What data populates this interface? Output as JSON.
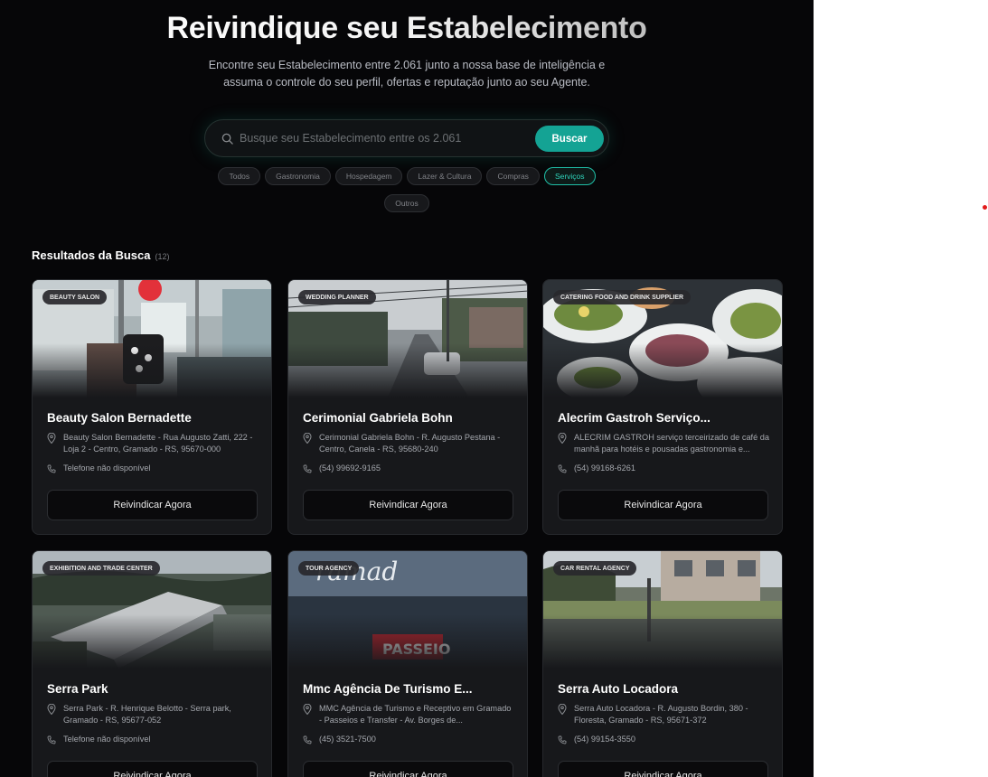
{
  "header": {
    "title": "Reivindique seu Estabelecimento",
    "subtitle": "Encontre seu Estabelecimento entre 2.061 junto a nossa base de inteligência e assuma o controle do seu perfil, ofertas e reputação junto ao seu Agente."
  },
  "search": {
    "placeholder": "Busque seu Estabelecimento entre os 2.061",
    "button_label": "Buscar"
  },
  "filters": [
    {
      "label": "Todos",
      "active": false
    },
    {
      "label": "Gastronomia",
      "active": false
    },
    {
      "label": "Hospedagem",
      "active": false
    },
    {
      "label": "Lazer & Cultura",
      "active": false
    },
    {
      "label": "Compras",
      "active": false
    },
    {
      "label": "Serviços",
      "active": true
    },
    {
      "label": "Outros",
      "active": false
    }
  ],
  "results": {
    "title": "Resultados da Busca",
    "count": "(12)"
  },
  "cards": [
    {
      "category": "Beauty Salon",
      "name": "Beauty Salon Bernadette",
      "address": "Beauty Salon Bernadette - Rua Augusto Zatti, 222 - Loja 2 - Centro, Gramado - RS, 95670-000",
      "phone": "Telefone não disponível",
      "button": "Reivindicar Agora"
    },
    {
      "category": "Wedding Planner",
      "name": "Cerimonial Gabriela Bohn",
      "address": "Cerimonial Gabriela Bohn - R. Augusto Pestana - Centro, Canela - RS, 95680-240",
      "phone": "(54) 99692-9165",
      "button": "Reivindicar Agora"
    },
    {
      "category": "Catering Food and Drink Supplier",
      "name": "Alecrim Gastroh Serviço...",
      "address": "ALECRIM GASTROH serviço terceirizado de café da manhã para hotéis e pousadas gastronomia e...",
      "phone": "(54) 99168-6261",
      "button": "Reivindicar Agora"
    },
    {
      "category": "Exhibition and Trade Center",
      "name": "Serra Park",
      "address": "Serra Park - R. Henrique Belotto - Serra park, Gramado - RS, 95677-052",
      "phone": "Telefone não disponível",
      "button": "Reivindicar Agora"
    },
    {
      "category": "Tour Agency",
      "name": "Mmc Agência De Turismo E...",
      "address": "MMC Agência de Turismo e Receptivo em Gramado - Passeios e Transfer - Av. Borges de...",
      "phone": "(45) 3521-7500",
      "button": "Reivindicar Agora"
    },
    {
      "category": "Car Rental Agency",
      "name": "Serra Auto Locadora",
      "address": "Serra Auto Locadora - R. Augusto Bordin, 380 - Floresta, Gramado - RS, 95671-372",
      "phone": "(54) 99154-3550",
      "button": "Reivindicar Agora"
    }
  ],
  "photo_texts": {
    "sign_word": "ramad",
    "banner_word": "PASSEIO"
  },
  "colors": {
    "accent": "#14a394",
    "active_chip": "#1fbfa7",
    "background": "#060608",
    "card": "#17181b"
  }
}
